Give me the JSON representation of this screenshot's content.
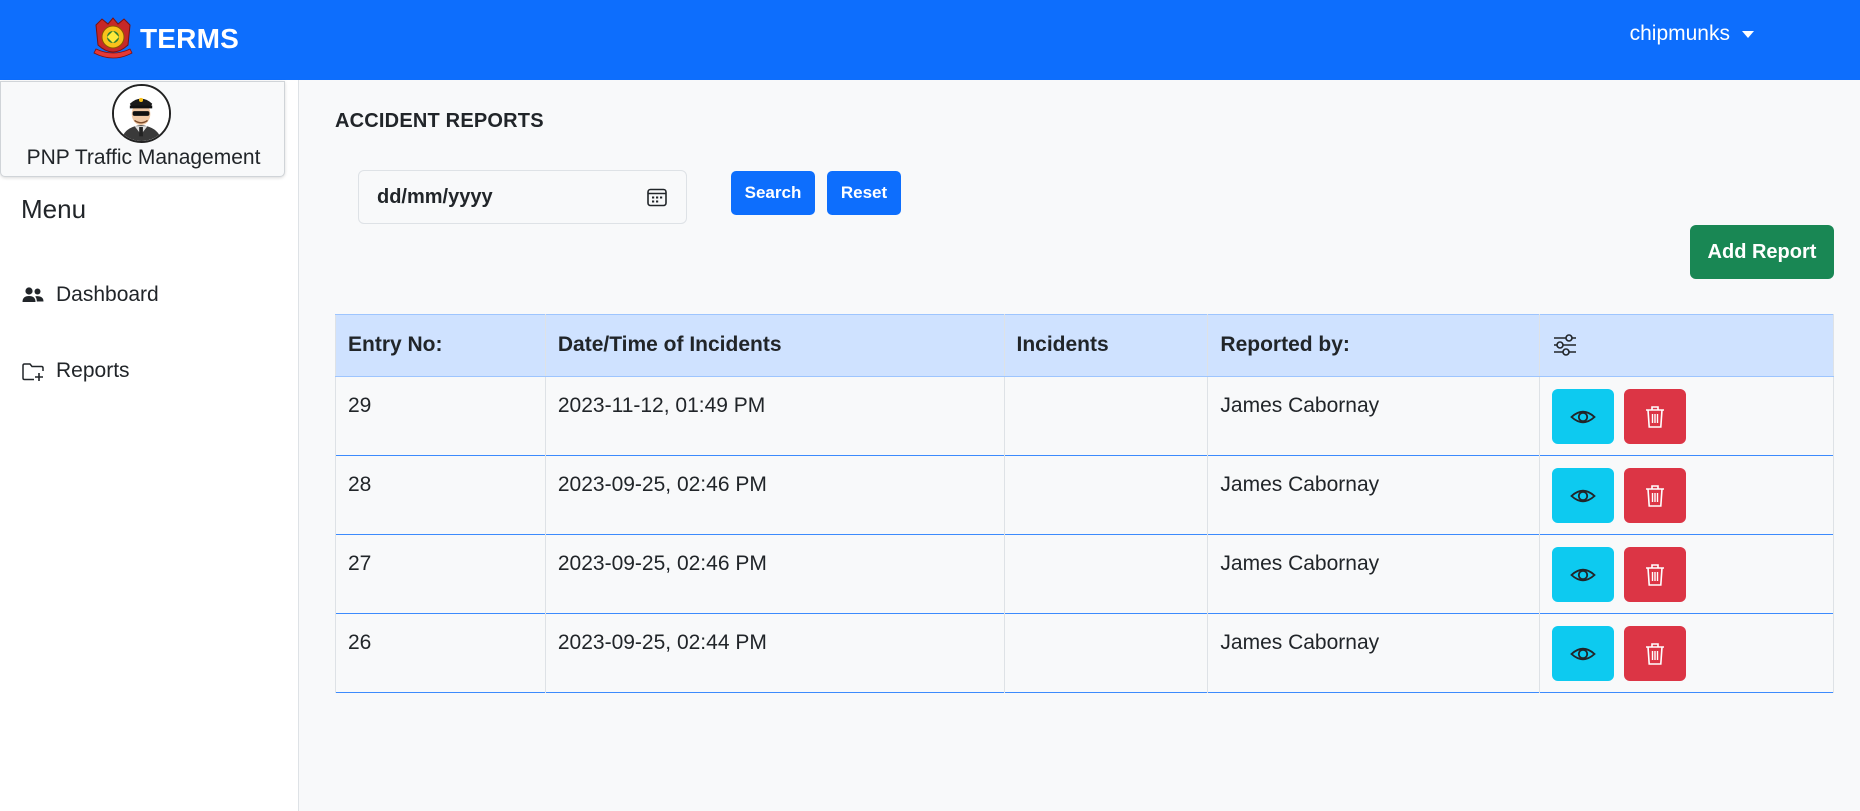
{
  "navbar": {
    "brand": "TERMS",
    "user": "chipmunks"
  },
  "sidebar": {
    "profile_name": "PNP Traffic Management",
    "menu_title": "Menu",
    "items": [
      {
        "label": "Dashboard",
        "icon": "people-icon"
      },
      {
        "label": "Reports",
        "icon": "folder-plus-icon"
      }
    ]
  },
  "main": {
    "title": "ACCIDENT REPORTS",
    "date_filter": {
      "placeholder": "dd/mm/yyyy"
    },
    "search_label": "Search",
    "reset_label": "Reset",
    "add_label": "Add Report"
  },
  "table": {
    "headers": [
      "Entry No:",
      "Date/Time of Incidents",
      "Incidents",
      "Reported by:"
    ],
    "action_header_icon": "sliders-icon",
    "rows": [
      {
        "entry": "29",
        "datetime": "2023-11-12, 01:49 PM",
        "incidents": "",
        "reported_by": "James Cabornay"
      },
      {
        "entry": "28",
        "datetime": "2023-09-25, 02:46 PM",
        "incidents": "",
        "reported_by": "James Cabornay"
      },
      {
        "entry": "27",
        "datetime": "2023-09-25, 02:46 PM",
        "incidents": "",
        "reported_by": "James Cabornay"
      },
      {
        "entry": "26",
        "datetime": "2023-09-25, 02:44 PM",
        "incidents": "",
        "reported_by": "James Cabornay"
      }
    ]
  },
  "colors": {
    "primary": "#0d6efd",
    "success": "#198754",
    "info": "#0dcaf0",
    "danger": "#dc3545",
    "table_header": "#cfe2ff"
  }
}
